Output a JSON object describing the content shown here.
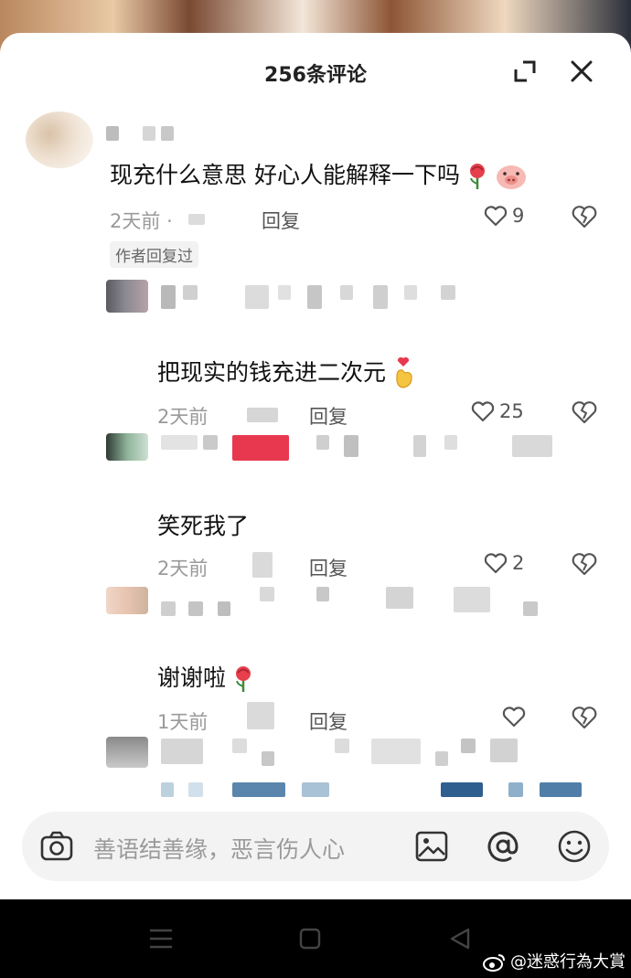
{
  "header": {
    "title": "256条评论"
  },
  "comments": [
    {
      "text": "现充什么意思 好心人能解释一下吗",
      "emojis": [
        "rose-emoji",
        "pig-emoji"
      ],
      "time": "2天前",
      "dot": "·",
      "reply_label": "回复",
      "likes": "9",
      "author_tag": "作者回复过"
    },
    {
      "text": "把现实的钱充进二次元",
      "emojis": [
        "finger-heart-emoji"
      ],
      "time": "2天前",
      "reply_label": "回复",
      "likes": "25"
    },
    {
      "text": "笑死我了",
      "time": "2天前",
      "reply_label": "回复",
      "likes": "2"
    },
    {
      "text": "谢谢啦",
      "emojis": [
        "rose-emoji"
      ],
      "time": "1天前",
      "reply_label": "回复",
      "likes": ""
    }
  ],
  "input": {
    "placeholder": "善语结善缘，恶言伤人心"
  },
  "watermark": {
    "text": "@迷惑行為大賞"
  },
  "colors": {
    "accent_red": "#e8384f",
    "text_primary": "#111111",
    "text_meta": "#9a9a9a"
  }
}
